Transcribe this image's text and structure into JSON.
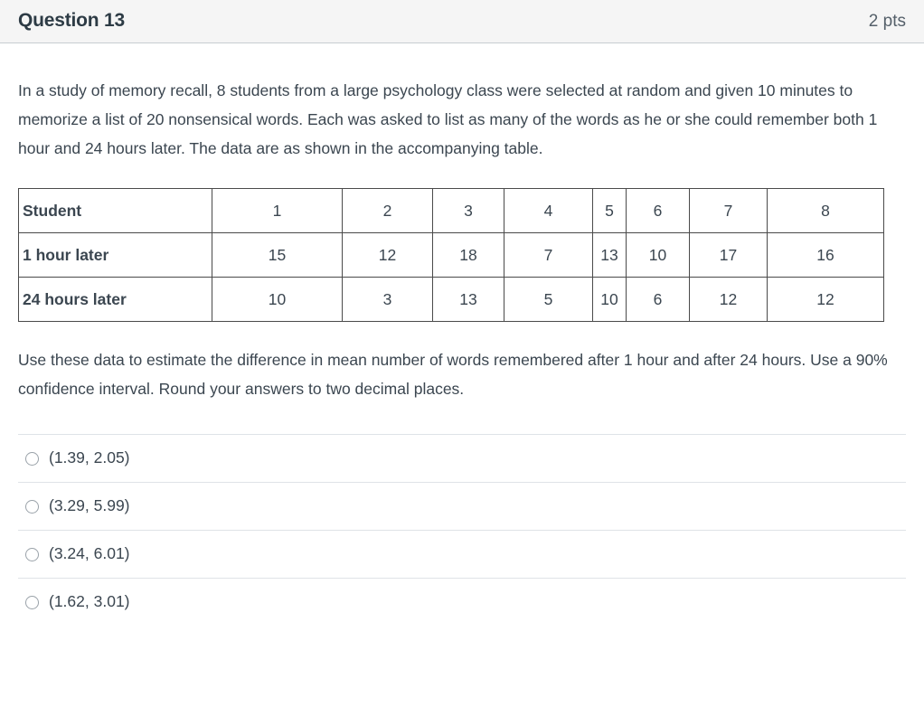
{
  "header": {
    "title": "Question 13",
    "points": "2 pts"
  },
  "question": {
    "intro": "In a study of memory recall, 8 students from a large psychology class were selected at random and given 10 minutes to memorize a list of 20 nonsensical words. Each was asked to list as many of the words as he or she could remember both 1 hour and 24 hours later. The data are as shown in the accompanying table.",
    "prompt": "Use these data to estimate the difference in mean number of words remembered after 1 hour and after 24 hours. Use a 90% confidence interval. Round your answers to two decimal places."
  },
  "table": {
    "row_labels": [
      "Student",
      "1 hour later",
      "24 hours later"
    ],
    "students": [
      "1",
      "2",
      "3",
      "4",
      "5",
      "6",
      "7",
      "8"
    ],
    "one_hour_later": [
      "15",
      "12",
      "18",
      "7",
      "13",
      "10",
      "17",
      "16"
    ],
    "twenty_four_hours_later": [
      "10",
      "3",
      "13",
      "5",
      "10",
      "6",
      "12",
      "12"
    ]
  },
  "answers": [
    {
      "label": "(1.39, 2.05)"
    },
    {
      "label": "(3.29, 5.99)"
    },
    {
      "label": "(3.24, 6.01)"
    },
    {
      "label": "(1.62, 3.01)"
    }
  ],
  "colors": {
    "header_bg": "#f5f5f5",
    "header_border": "#c7cdd1",
    "text": "#3b4650",
    "table_border": "#4a4a4a",
    "divider": "#dfe3e7"
  }
}
